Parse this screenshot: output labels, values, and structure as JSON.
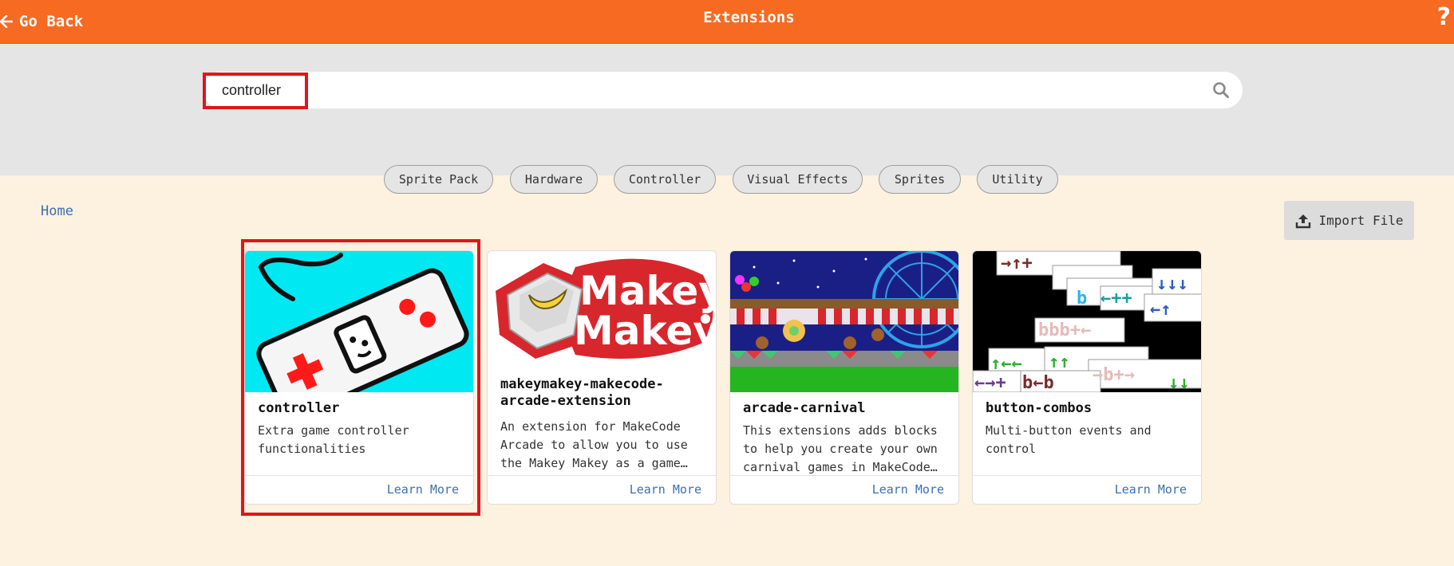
{
  "header": {
    "back_label": "Go Back",
    "title": "Extensions",
    "help_label": "?"
  },
  "search": {
    "value": "controller",
    "placeholder": ""
  },
  "tags": [
    "Sprite Pack",
    "Hardware",
    "Controller",
    "Visual Effects",
    "Sprites",
    "Utility"
  ],
  "breadcrumb": "Home",
  "import_label": "Import File",
  "cards": [
    {
      "title": "controller",
      "desc": "Extra game controller functionalities",
      "link": "Learn More"
    },
    {
      "title": "makeymakey-makecode-arcade-extension",
      "desc": "An extension for MakeCode Arcade to allow you to use the Makey Makey as a game…",
      "link": "Learn More"
    },
    {
      "title": "arcade-carnival",
      "desc": "This extensions adds blocks to help you create your own carnival games in MakeCode…",
      "link": "Learn More"
    },
    {
      "title": "button-combos",
      "desc": "Multi-button events and control",
      "link": "Learn More"
    }
  ],
  "makey_logo_text": [
    "Makey",
    "Makey"
  ],
  "colors": {
    "header": "#f66a22",
    "search_area": "#e5e5e5",
    "page_bg": "#fdf1e0",
    "link": "#3c6fb0",
    "highlight": "#e0151c"
  }
}
